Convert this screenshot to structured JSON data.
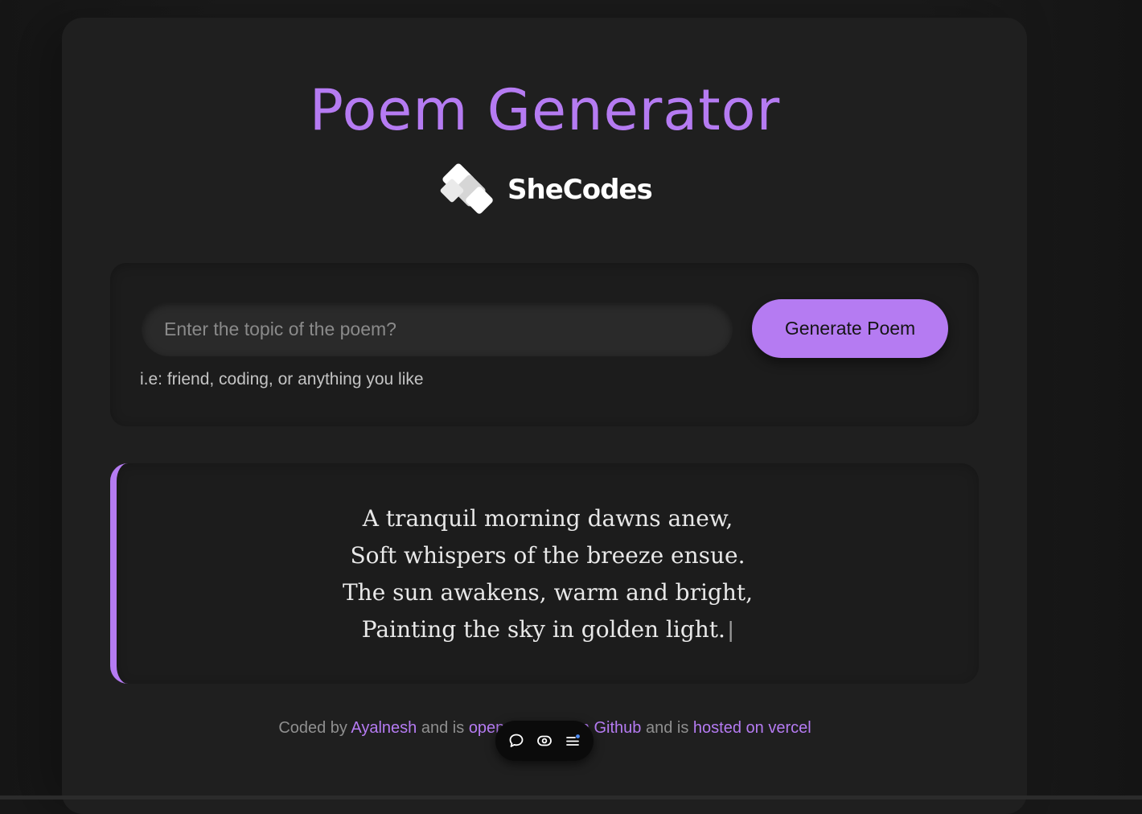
{
  "app": {
    "title": "Poem Generator",
    "brand": "SheCodes"
  },
  "form": {
    "input_placeholder": "Enter the topic of the poem?",
    "input_value": "",
    "button_label": "Generate Poem",
    "hint": "i.e: friend, coding, or anything you like"
  },
  "poem": {
    "lines": [
      "A tranquil morning dawns anew,",
      "Soft whispers of the breeze ensue.",
      "The sun awakens, warm and bright,",
      "Painting the sky in golden light."
    ],
    "caret": "|"
  },
  "footer": {
    "prefix": "Coded by",
    "author": "Ayalnesh",
    "mid1": "and is",
    "open_source": "open-sourced on",
    "github": "Github",
    "mid2": "and is",
    "hosted": "hosted on vercel"
  },
  "toolbar": {
    "icons": [
      "comment-icon",
      "eye-icon",
      "menu-icon"
    ]
  },
  "colors": {
    "accent": "#b57bf2",
    "background": "#1f1f1f",
    "text": "#e8e8e8"
  }
}
